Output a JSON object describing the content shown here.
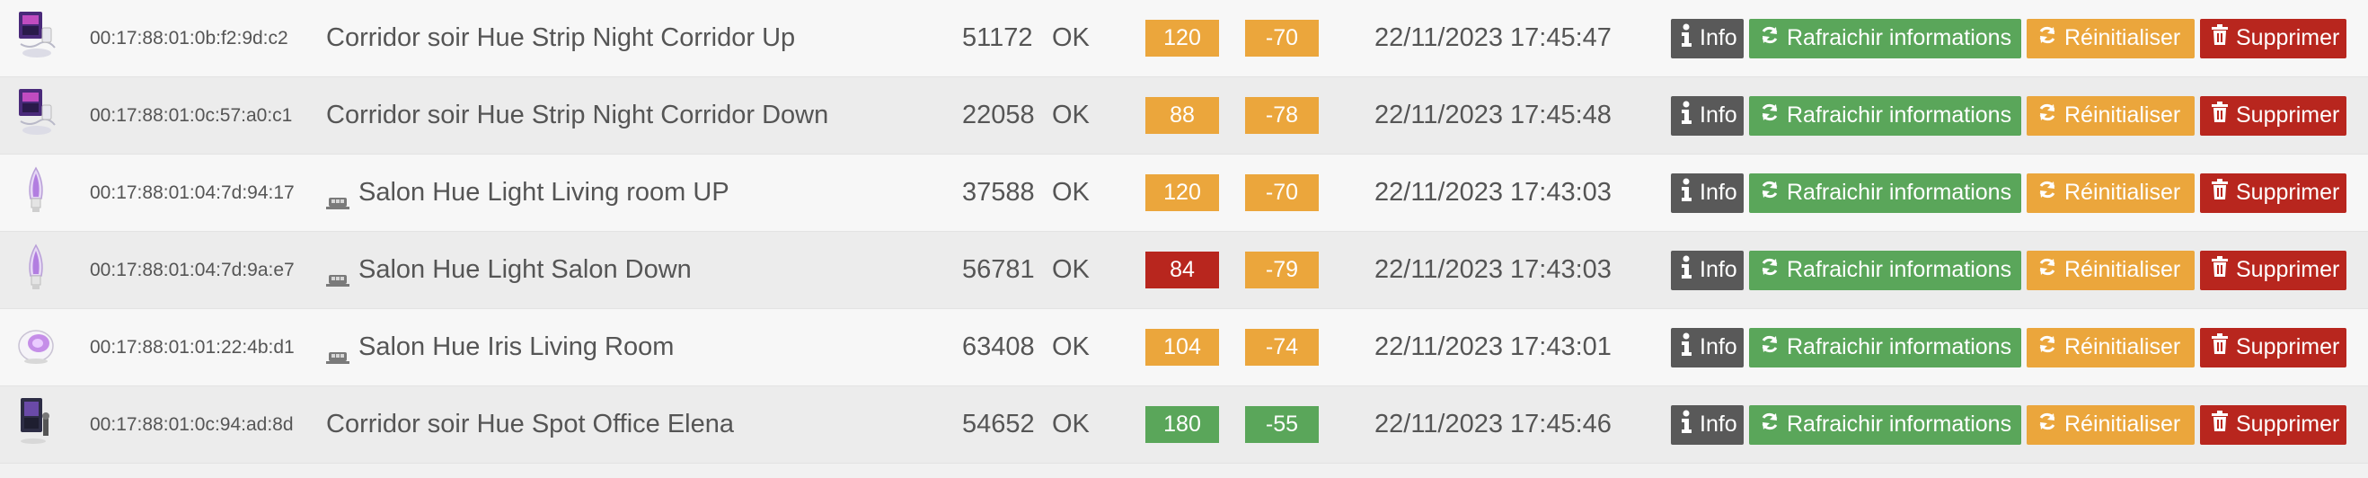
{
  "colors": {
    "orange": "#eba63c",
    "red": "#b8261e",
    "green": "#5aa65a",
    "dark": "#595959"
  },
  "actions": {
    "info_label": "Info",
    "refresh_label": "Rafraichir informations",
    "reset_label": "Réinitialiser",
    "delete_label": "Supprimer"
  },
  "rows": [
    {
      "icon": "hue-lightstrip-box-icon",
      "mac": "00:17:88:01:0b:f2:9d:c2",
      "mesh": false,
      "name": "Corridor soir Hue Strip Night Corridor Up",
      "number": "51172",
      "status": "OK",
      "value1": "120",
      "value1_color": "orange",
      "value2": "-70",
      "value2_color": "orange",
      "date": "22/11/2023 17:45:47"
    },
    {
      "icon": "hue-lightstrip-box-icon",
      "mac": "00:17:88:01:0c:57:a0:c1",
      "mesh": false,
      "name": "Corridor soir Hue Strip Night Corridor Down",
      "number": "22058",
      "status": "OK",
      "value1": "88",
      "value1_color": "orange",
      "value2": "-78",
      "value2_color": "orange",
      "date": "22/11/2023 17:45:48"
    },
    {
      "icon": "candle-bulb-icon",
      "mac": "00:17:88:01:04:7d:94:17",
      "mesh": true,
      "name": "Salon Hue Light Living room UP",
      "number": "37588",
      "status": "OK",
      "value1": "120",
      "value1_color": "orange",
      "value2": "-70",
      "value2_color": "orange",
      "date": "22/11/2023 17:43:03"
    },
    {
      "icon": "candle-bulb-icon",
      "mac": "00:17:88:01:04:7d:9a:e7",
      "mesh": true,
      "name": "Salon Hue Light Salon Down",
      "number": "56781",
      "status": "OK",
      "value1": "84",
      "value1_color": "red",
      "value2": "-79",
      "value2_color": "orange",
      "date": "22/11/2023 17:43:03"
    },
    {
      "icon": "hue-iris-lamp-icon",
      "mac": "00:17:88:01:01:22:4b:d1",
      "mesh": true,
      "name": "Salon Hue Iris Living Room",
      "number": "63408",
      "status": "OK",
      "value1": "104",
      "value1_color": "orange",
      "value2": "-74",
      "value2_color": "orange",
      "date": "22/11/2023 17:43:01"
    },
    {
      "icon": "hue-spot-box-icon",
      "mac": "00:17:88:01:0c:94:ad:8d",
      "mesh": false,
      "name": "Corridor soir Hue Spot Office Elena",
      "number": "54652",
      "status": "OK",
      "value1": "180",
      "value1_color": "green",
      "value2": "-55",
      "value2_color": "green",
      "date": "22/11/2023 17:45:46"
    }
  ]
}
